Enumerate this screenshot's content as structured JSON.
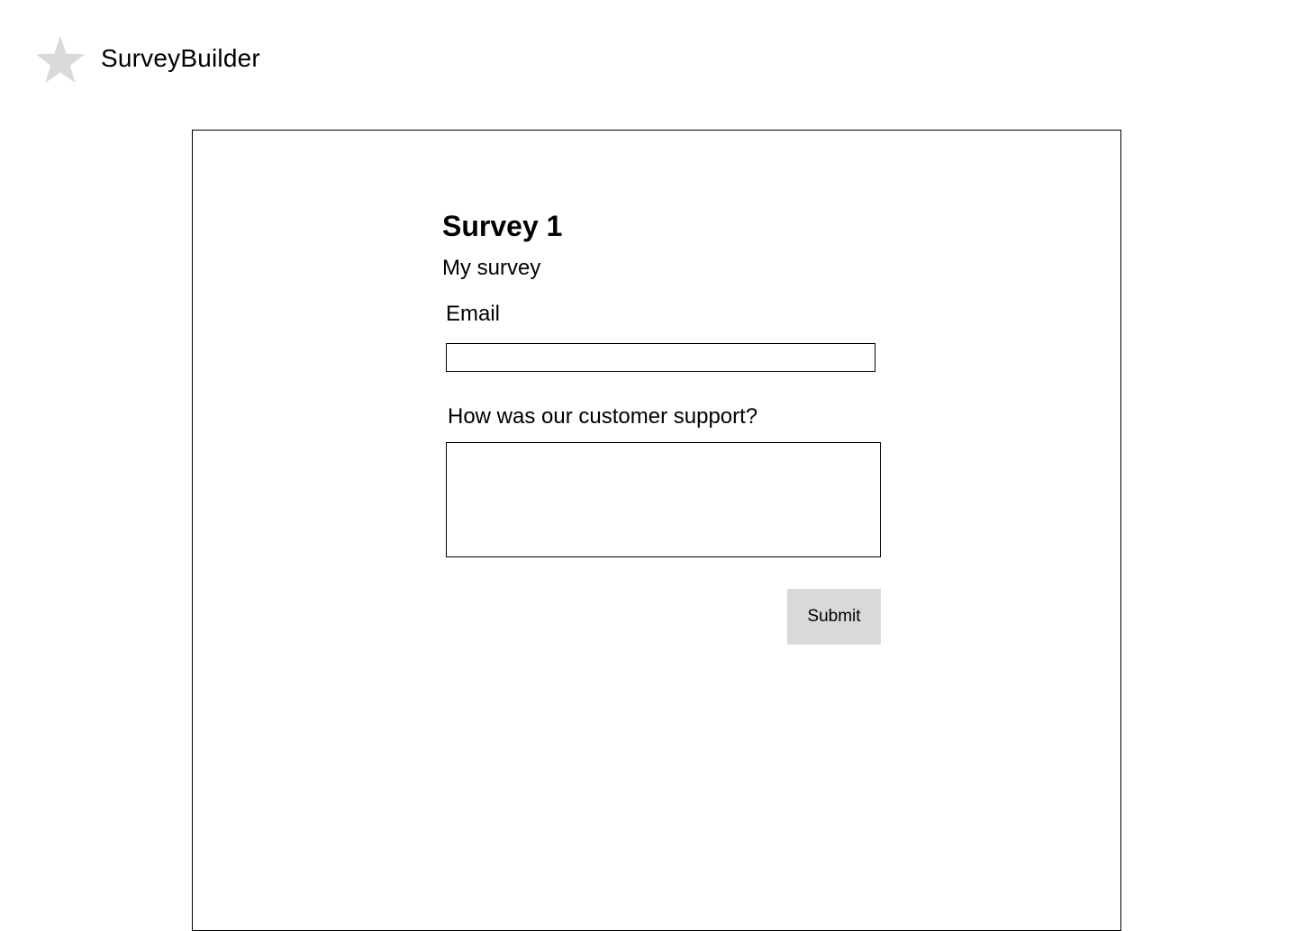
{
  "app": {
    "name": "SurveyBuilder",
    "logo_icon": "star-icon",
    "logo_color": "#d9d9d9"
  },
  "survey": {
    "title": "Survey 1",
    "description": "My survey",
    "fields": [
      {
        "label": "Email",
        "type": "text",
        "value": ""
      },
      {
        "label": "How was our customer support?",
        "type": "textarea",
        "value": ""
      }
    ],
    "submit_label": "Submit"
  },
  "colors": {
    "button_bg": "#d9d9d9",
    "border": "#000000"
  }
}
